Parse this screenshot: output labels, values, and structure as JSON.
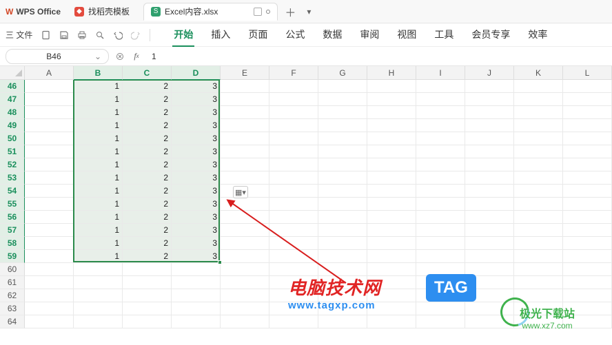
{
  "app": {
    "name": "WPS Office"
  },
  "tabs": [
    {
      "label": "找稻壳模板",
      "icon_bg": "#e34b3e"
    },
    {
      "label": "Excel内容.xlsx",
      "icon_letter": "S",
      "icon_bg": "#2fa06e",
      "active": true
    }
  ],
  "file_menu": "三 文件",
  "ribbon": [
    "开始",
    "插入",
    "页面",
    "公式",
    "数据",
    "审阅",
    "视图",
    "工具",
    "会员专享",
    "效率"
  ],
  "ribbon_active": 0,
  "namebox": "B46",
  "formula": "1",
  "columns": [
    "A",
    "B",
    "C",
    "D",
    "E",
    "F",
    "G",
    "H",
    "I",
    "J",
    "K",
    "L"
  ],
  "sel_cols": [
    "B",
    "C",
    "D"
  ],
  "rows": [
    46,
    47,
    48,
    49,
    50,
    51,
    52,
    53,
    54,
    55,
    56,
    57,
    58,
    59,
    60,
    61,
    62,
    63,
    64
  ],
  "sel_rows": [
    46,
    47,
    48,
    49,
    50,
    51,
    52,
    53,
    54,
    55,
    56,
    57,
    58,
    59
  ],
  "chart_data": {
    "type": "table",
    "columns": [
      "B",
      "C",
      "D"
    ],
    "row_start": 46,
    "row_end": 59,
    "data": [
      [
        1,
        2,
        3
      ],
      [
        1,
        2,
        3
      ],
      [
        1,
        2,
        3
      ],
      [
        1,
        2,
        3
      ],
      [
        1,
        2,
        3
      ],
      [
        1,
        2,
        3
      ],
      [
        1,
        2,
        3
      ],
      [
        1,
        2,
        3
      ],
      [
        1,
        2,
        3
      ],
      [
        1,
        2,
        3
      ],
      [
        1,
        2,
        3
      ],
      [
        1,
        2,
        3
      ],
      [
        1,
        2,
        3
      ],
      [
        1,
        2,
        3
      ]
    ]
  },
  "floatbutton": "▦▾",
  "watermark1": {
    "title": "电脑技术网",
    "url": "www.tagxp.com"
  },
  "tag": "TAG",
  "watermark2": {
    "title": "极光下载站",
    "url": "www.xz7.com"
  }
}
